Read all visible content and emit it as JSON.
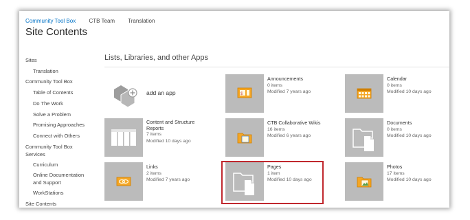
{
  "topnav": {
    "items": [
      "Community Tool Box",
      "CTB Team",
      "Translation"
    ]
  },
  "page_title": "Site Contents",
  "leftnav": {
    "items": [
      {
        "label": "Sites",
        "sub": false
      },
      {
        "label": "Translation",
        "sub": true
      },
      {
        "label": "Community Tool Box",
        "sub": false
      },
      {
        "label": "Table of Contents",
        "sub": true
      },
      {
        "label": "Do The Work",
        "sub": true
      },
      {
        "label": "Solve a Problem",
        "sub": true
      },
      {
        "label": "Promising Approaches",
        "sub": true
      },
      {
        "label": "Connect with Others",
        "sub": true
      },
      {
        "label": "Community Tool Box Services",
        "sub": false
      },
      {
        "label": "Curriculum",
        "sub": true
      },
      {
        "label": "Online Documentation and Support",
        "sub": true
      },
      {
        "label": "WorkStations",
        "sub": true
      },
      {
        "label": "Site Contents",
        "sub": false
      }
    ]
  },
  "section_heading": "Lists, Libraries, and other Apps",
  "add_app_label": "add an app",
  "apps": [
    {
      "name": "Announcements",
      "count": "0 items",
      "modified": "Modified 7 years ago",
      "icon": "announcement-icon"
    },
    {
      "name": "Calendar",
      "count": "0 items",
      "modified": "Modified 10 days ago",
      "icon": "calendar-icon"
    },
    {
      "name": "Content and Structure Reports",
      "count": "7 items",
      "modified": "Modified 10 days ago",
      "icon": "table-icon"
    },
    {
      "name": "CTB Collaborative Wikis",
      "count": "16 items",
      "modified": "Modified 6 years ago",
      "icon": "wiki-library-icon"
    },
    {
      "name": "Documents",
      "count": "0 items",
      "modified": "Modified 10 days ago",
      "icon": "document-library-icon"
    },
    {
      "name": "Links",
      "count": "2 items",
      "modified": "Modified 7 years ago",
      "icon": "link-icon"
    },
    {
      "name": "Pages",
      "count": "1 item",
      "modified": "Modified 10 days ago",
      "icon": "pages-library-icon"
    },
    {
      "name": "Photos",
      "count": "17 items",
      "modified": "Modified 10 days ago",
      "icon": "picture-library-icon"
    }
  ],
  "colors": {
    "accent": "#0072c6",
    "tile": "#bbbbbb",
    "highlight": "#c0272d",
    "icon_orange": "#f5a623"
  }
}
